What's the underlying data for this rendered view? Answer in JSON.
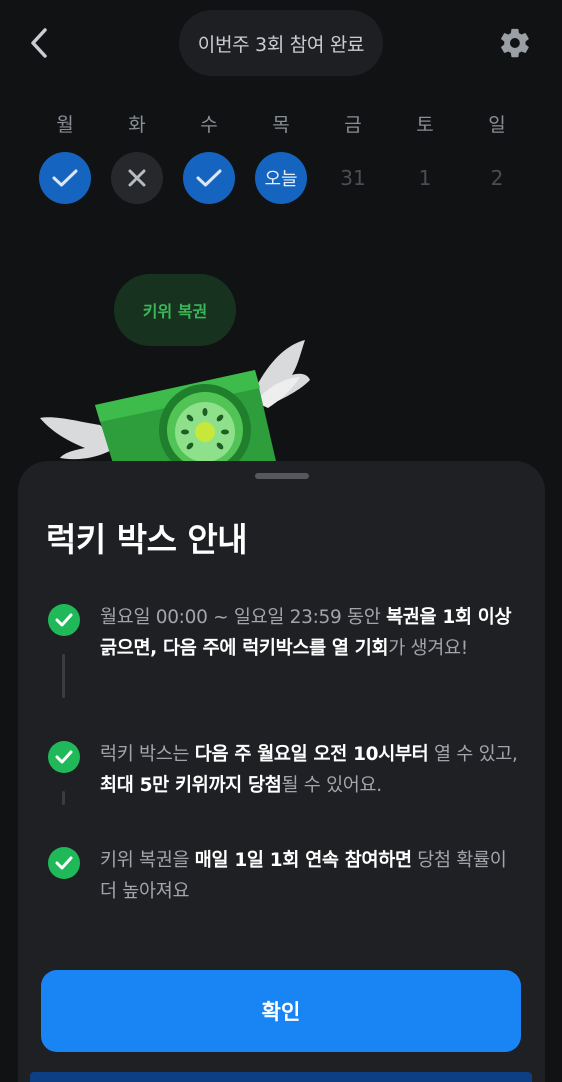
{
  "header": {
    "back_icon": "chevron-left-icon",
    "status_text": "이번주 3회 참여 완료",
    "settings_icon": "gear-icon"
  },
  "week": [
    {
      "label": "월",
      "mark": "",
      "state": "done"
    },
    {
      "label": "화",
      "mark": "",
      "state": "missed"
    },
    {
      "label": "수",
      "mark": "",
      "state": "done"
    },
    {
      "label": "목",
      "mark": "오늘",
      "state": "today"
    },
    {
      "label": "금",
      "mark": "31",
      "state": "future"
    },
    {
      "label": "토",
      "mark": "1",
      "state": "future"
    },
    {
      "label": "일",
      "mark": "2",
      "state": "future"
    }
  ],
  "ticket_bubble": "키위 복권",
  "sheet": {
    "title": "럭키 박스 안내",
    "items": [
      {
        "segments": [
          {
            "text": "월요일 00:00 ~ 일요일 23:59 동안 ",
            "bold": false
          },
          {
            "text": "복권을 1회 이상 긁으면, 다음 주에 럭키박스를 열 기회",
            "bold": true
          },
          {
            "text": "가 생겨요!",
            "bold": false
          }
        ]
      },
      {
        "segments": [
          {
            "text": "럭키 박스는 ",
            "bold": false
          },
          {
            "text": "다음 주 월요일 오전 10시부터",
            "bold": true
          },
          {
            "text": " 열 수 있고, ",
            "bold": false
          },
          {
            "text": "최대 5만 키위까지 당첨",
            "bold": true
          },
          {
            "text": "될 수 있어요.",
            "bold": false
          }
        ]
      },
      {
        "segments": [
          {
            "text": "키위 복권을 ",
            "bold": false
          },
          {
            "text": "매일 1일 1회 연속 참여하면",
            "bold": true
          },
          {
            "text": " 당첨 확률이 더 높아져요",
            "bold": false
          }
        ]
      }
    ],
    "confirm_label": "확인"
  },
  "colors": {
    "background": "#111214",
    "sheet": "#1f2024",
    "accent_blue": "#1985f5",
    "check_green": "#1fb95a"
  }
}
